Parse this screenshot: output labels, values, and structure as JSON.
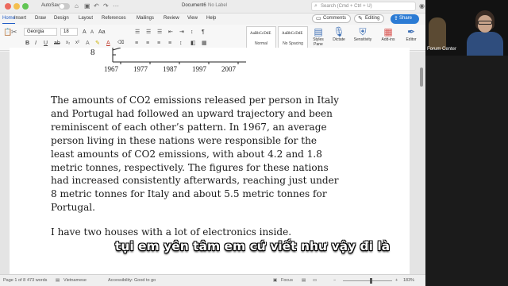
{
  "window": {
    "autosave_label": "AutoSave",
    "doc_title": "Document6",
    "label_status": "No Label",
    "search_placeholder": "Search (Cmd + Ctrl + U)"
  },
  "tabs": [
    "Home",
    "Insert",
    "Draw",
    "Design",
    "Layout",
    "References",
    "Mailings",
    "Review",
    "View",
    "Help"
  ],
  "active_tab": "Home",
  "actions": {
    "comments": "Comments",
    "editing": "Editing",
    "share": "Share"
  },
  "ribbon": {
    "font_name": "Georgia",
    "font_size": "18",
    "style_normal_preview": "AaBbCcDdE",
    "style_normal_label": "Normal",
    "style_nospacing_preview": "AaBbCcDdE",
    "style_nospacing_label": "No Spacing",
    "styles_pane": "Styles Pane",
    "dictate": "Dictate",
    "sensitivity": "Sensitivity",
    "addins": "Add-ins",
    "editor": "Editor"
  },
  "chart_axis": {
    "y_fragment": "8",
    "ticks": [
      "1967",
      "1977",
      "1987",
      "1997",
      "2007"
    ]
  },
  "document": {
    "paragraph_lines": [
      "The amounts of CO2 emissions released per person in Italy",
      "and Portugal had followed an upward trajectory and been",
      "reminiscent of each other’s pattern. In 1967, an average",
      "person living in these nations were responsible for the",
      "least amounts of CO2 emissions, with about 4.2 and 1.8",
      "metric tonnes, respectively. The figures for these nations",
      "had increased consistently afterwards, reaching just under",
      "8 metric tonnes for Italy and about 5.5 metric tonnes for",
      "Portugal."
    ],
    "paragraph2": "I have two houses with a lot of electronics inside."
  },
  "status": {
    "page": "Page 1 of 8",
    "words": "473 words",
    "language": "Vietnamese",
    "accessibility": "Accessibility: Good to go",
    "focus": "Focus",
    "zoom": "183%"
  },
  "video": {
    "name": "Forum Center"
  },
  "subtitle": "tụi em yên tâm em cứ viết như vậy đi là",
  "colors": {
    "accent": "#1f5bc5",
    "share": "#2b7bd4"
  }
}
